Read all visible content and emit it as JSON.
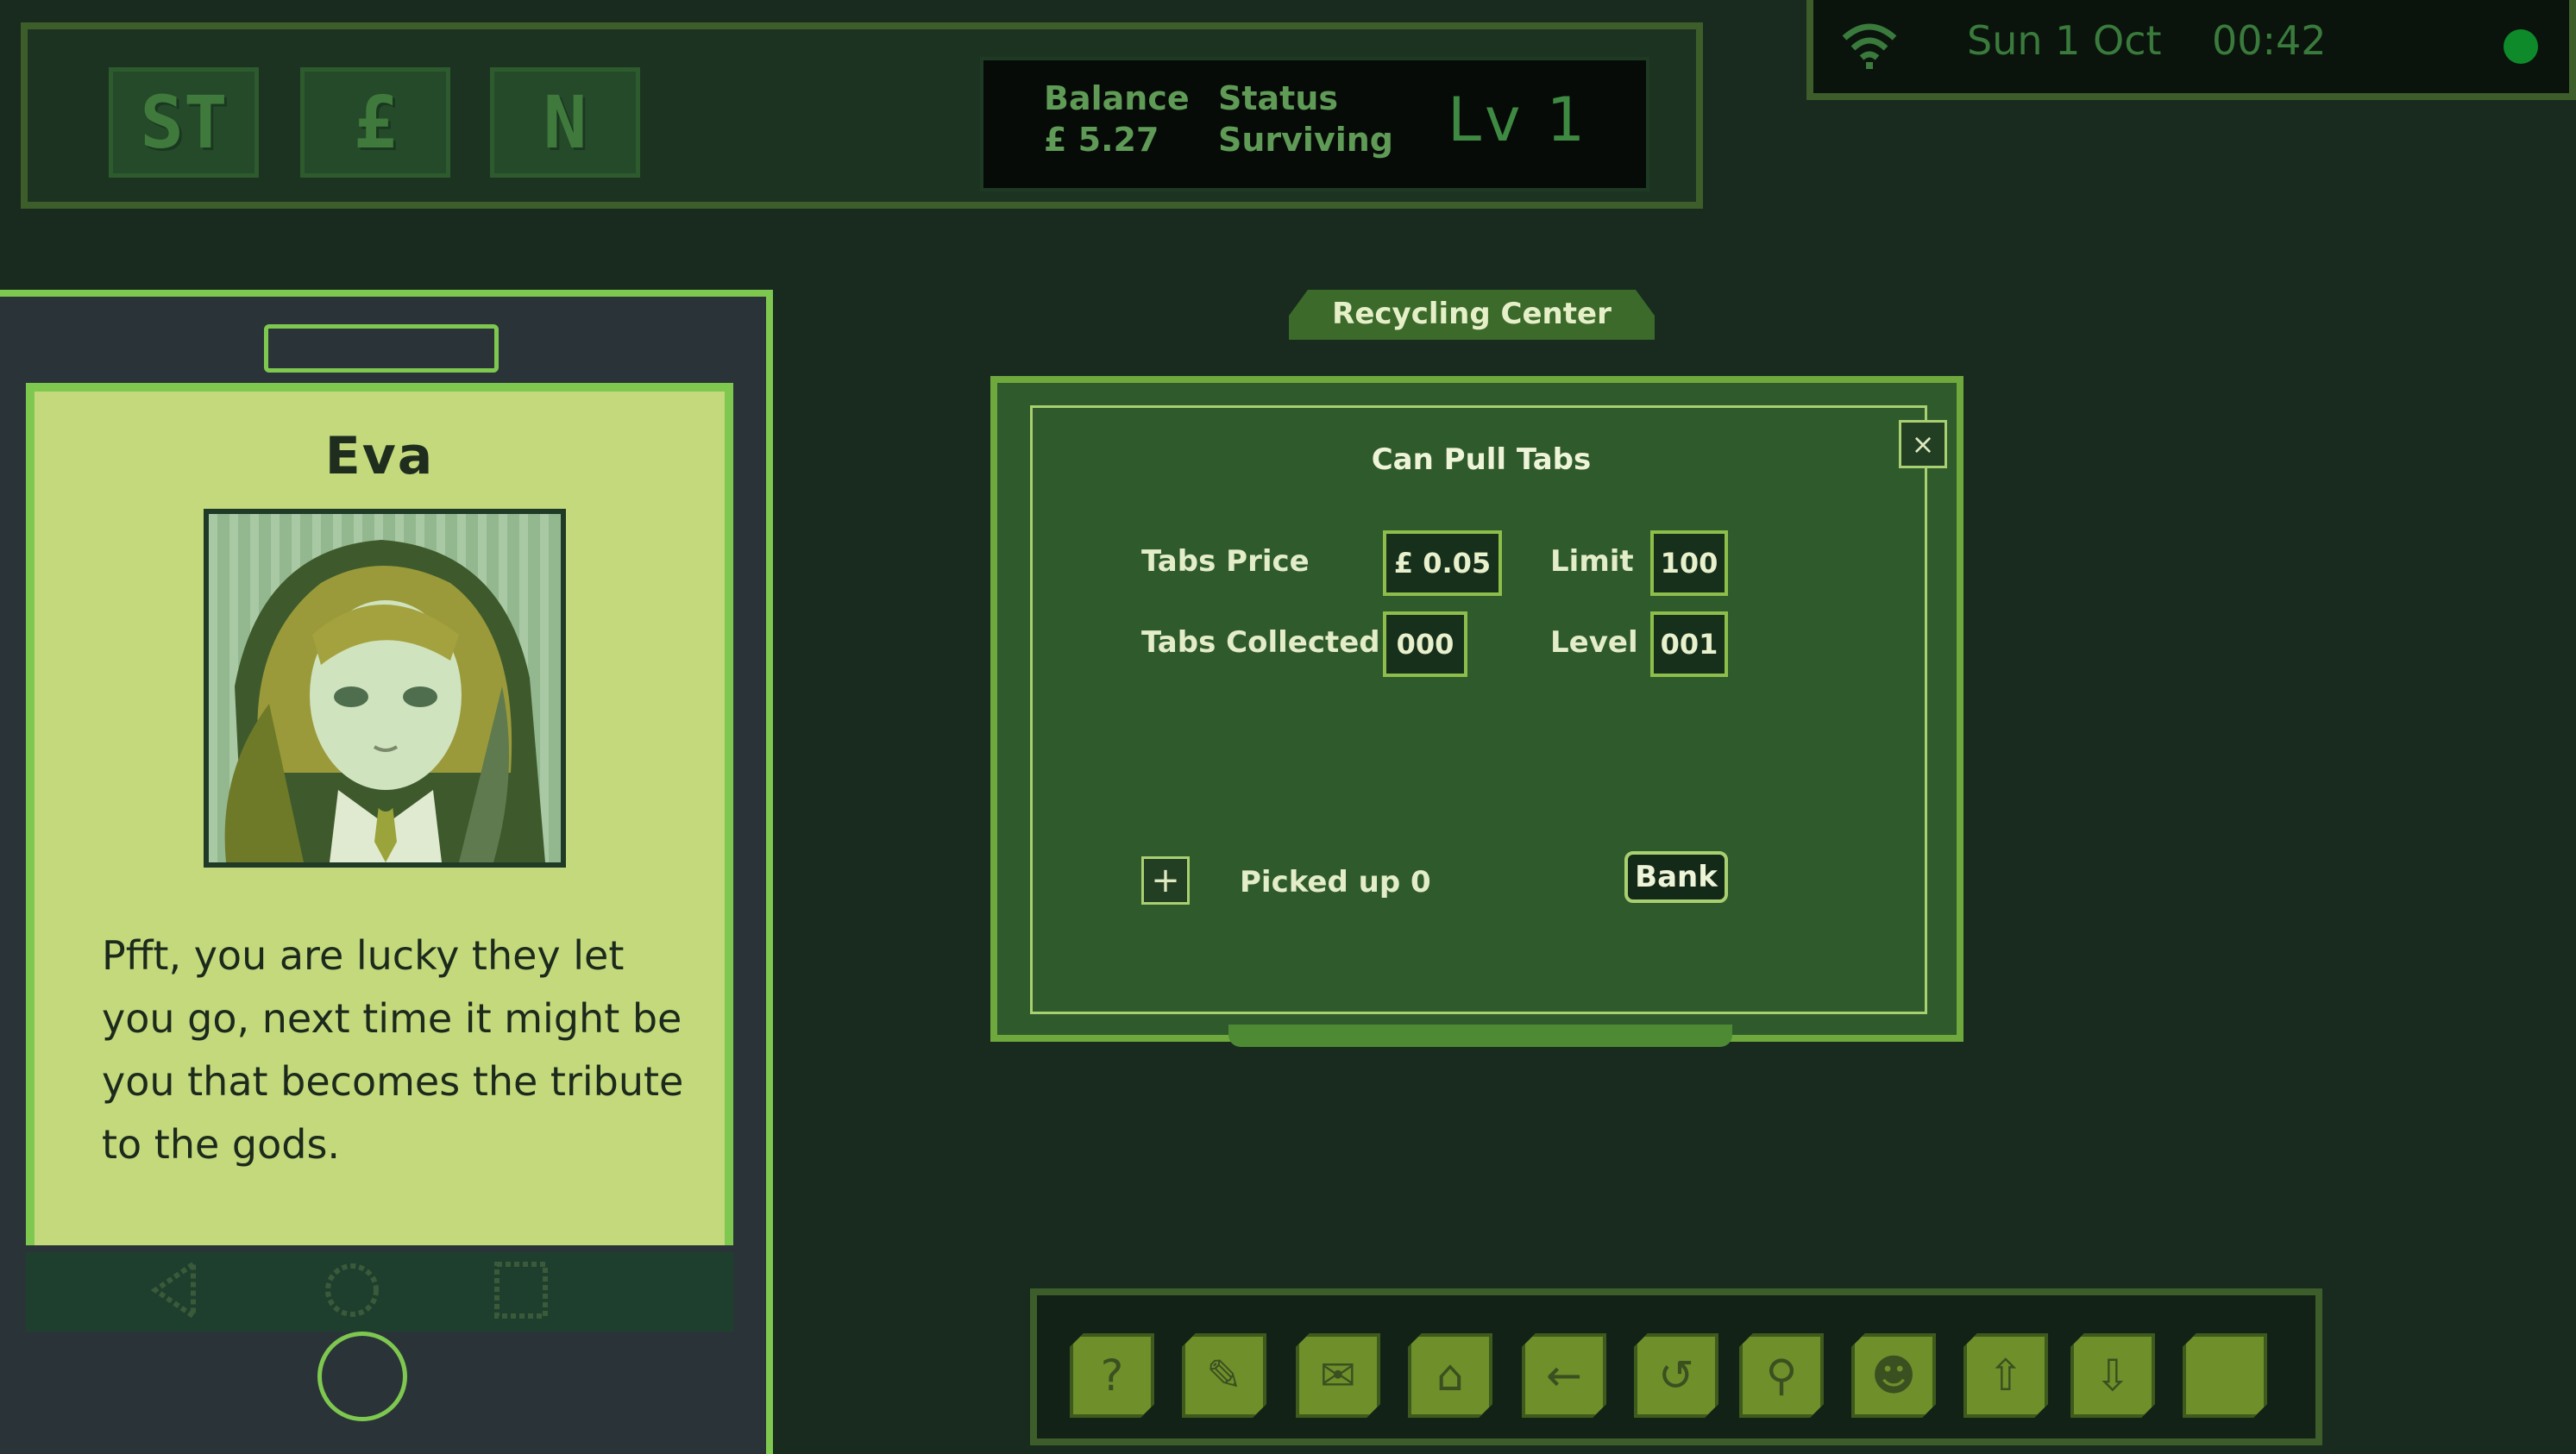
{
  "top_nav": {
    "buttons": [
      "ST",
      "£",
      "N"
    ]
  },
  "stats": {
    "balance_label": "Balance",
    "balance_value": "£ 5.27",
    "status_label": "Status",
    "status_value": "Surviving",
    "level": "Lv 1"
  },
  "status_bar": {
    "date": "Sun 1 Oct",
    "time": "00:42",
    "wifi_icon": "wifi-icon",
    "online_color": "#0f8a2a"
  },
  "phone": {
    "contact_name": "Eva",
    "message": "Pfft, you are lucky they let you go, next time it might be you that becomes the tribute to the gods.",
    "nav_icons": [
      "back-triangle-icon",
      "home-circle-icon",
      "recent-square-icon"
    ]
  },
  "recycling": {
    "location_tab": "Recycling Center",
    "title": "Can Pull Tabs",
    "close_label": "×",
    "fields": {
      "tabs_price_label": "Tabs Price",
      "tabs_price_value": "£ 0.05",
      "limit_label": "Limit",
      "limit_value": "100",
      "tabs_collected_label": "Tabs Collected",
      "tabs_collected_value": "000",
      "level_label": "Level",
      "level_value": "001"
    },
    "plus_label": "+",
    "picked_up_text": "Picked up 0",
    "bank_label": "Bank"
  },
  "toolbar": {
    "icons": [
      "help-icon",
      "note-icon",
      "mail-icon",
      "house-icon",
      "back-arrow-icon",
      "refresh-icon",
      "search-icon",
      "people-icon",
      "upload-icon",
      "download-icon",
      "blank-icon"
    ],
    "glyphs": [
      "?",
      "✎",
      "✉",
      "⌂",
      "←",
      "↺",
      "⚲",
      "☻",
      "⇧",
      "⇩",
      ""
    ]
  },
  "colors": {
    "background": "#182b1e",
    "accent_green": "#7ec850",
    "panel_green": "#2f5a2c",
    "screen": "#c4d87c"
  }
}
